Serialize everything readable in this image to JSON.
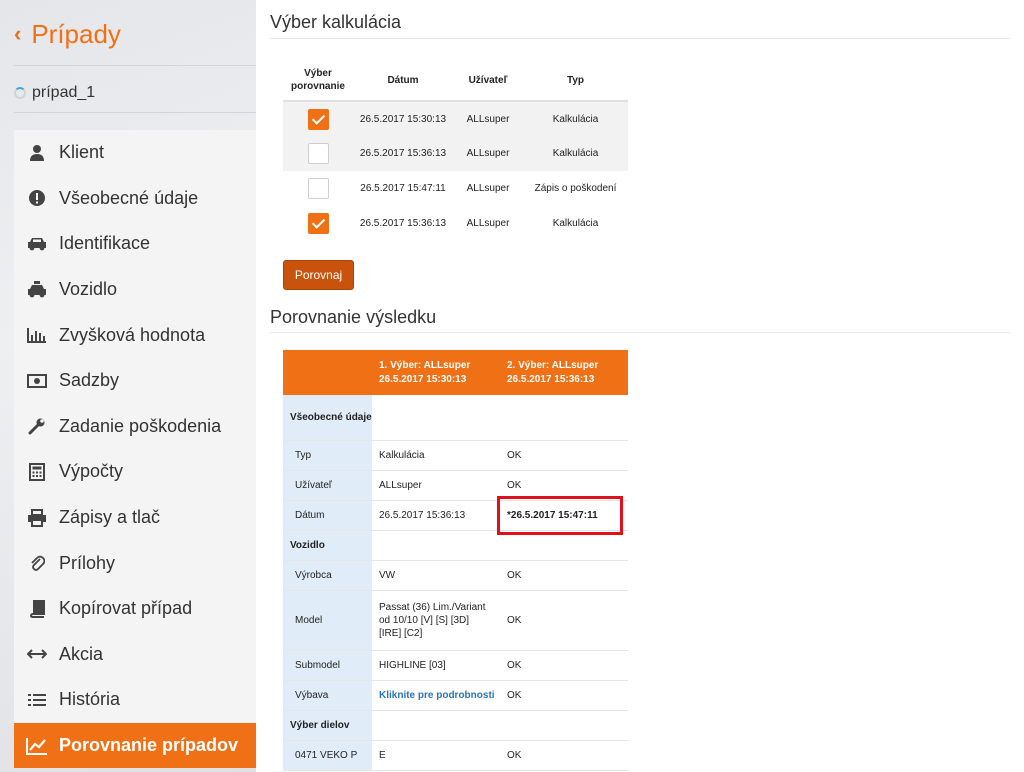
{
  "sidebar": {
    "back_label": "Prípady",
    "case_name": "prípad_1",
    "items": [
      {
        "label": "Klient",
        "icon": "user-icon"
      },
      {
        "label": "Všeobecné údaje",
        "icon": "exclamation-circle-icon"
      },
      {
        "label": "Identifikace",
        "icon": "car-icon"
      },
      {
        "label": "Vozidlo",
        "icon": "taxi-icon"
      },
      {
        "label": "Zvyšková hodnota",
        "icon": "bar-chart-icon"
      },
      {
        "label": "Sadzby",
        "icon": "money-icon"
      },
      {
        "label": "Zadanie poškodenia",
        "icon": "wrench-icon"
      },
      {
        "label": "Výpočty",
        "icon": "calculator-icon"
      },
      {
        "label": "Zápisy a tlač",
        "icon": "printer-icon"
      },
      {
        "label": "Prílohy",
        "icon": "paperclip-icon"
      },
      {
        "label": "Kopírovat případ",
        "icon": "book-icon"
      },
      {
        "label": "Akcia",
        "icon": "arrows-horizontal-icon"
      },
      {
        "label": "História",
        "icon": "list-icon"
      },
      {
        "label": "Porovnanie prípadov",
        "icon": "line-chart-icon",
        "active": true
      }
    ]
  },
  "selection": {
    "title": "Výber kalkulácia",
    "headers": {
      "select": "Výber porovnanie",
      "date": "Dátum",
      "user": "Užívateľ",
      "type": "Typ"
    },
    "rows": [
      {
        "checked": true,
        "date": "26.5.2017 15:30:13",
        "user": "ALLsuper",
        "type": "Kalkulácia"
      },
      {
        "checked": false,
        "date": "26.5.2017 15:36:13",
        "user": "ALLsuper",
        "type": "Kalkulácia"
      },
      {
        "checked": false,
        "date": "26.5.2017 15:47:11",
        "user": "ALLsuper",
        "type": "Zápis o poškodení"
      },
      {
        "checked": true,
        "date": "26.5.2017 15:36:13",
        "user": "ALLsuper",
        "type": "Kalkulácia"
      }
    ],
    "compare_button": "Porovnaj"
  },
  "comparison": {
    "title": "Porovnanie výsledku",
    "col1": {
      "line1": "1. Výber: ALLsuper",
      "line2": "26.5.2017 15:30:13"
    },
    "col2": {
      "line1": "2. Výber: ALLsuper",
      "line2": "26.5.2017 15:36:13"
    },
    "sec_general": "Všeobecné údaje",
    "typ": {
      "label": "Typ",
      "v1": "Kalkulácia",
      "v2": "OK"
    },
    "user": {
      "label": "Užívateľ",
      "v1": "ALLsuper",
      "v2": "OK"
    },
    "date": {
      "label": "Dátum",
      "v1": "26.5.2017 15:36:13",
      "v2": "*26.5.2017 15:47:11"
    },
    "sec_vehicle": "Vozidlo",
    "maker": {
      "label": "Výrobca",
      "v1": "VW",
      "v2": "OK"
    },
    "model": {
      "label": "Model",
      "v1a": "Passat (36) Lim./Variant",
      "v1b": "od 10/10 [V] [S] [3D]",
      "v1c": "[IRE] [C2]",
      "v2": "OK"
    },
    "submodel": {
      "label": "Submodel",
      "v1": "HIGHLINE [03]",
      "v2": "OK"
    },
    "equip": {
      "label": "Výbava",
      "v1": "Kliknite pre podrobnosti",
      "v2": "OK"
    },
    "sec_parts": "Výber dielov",
    "part1": {
      "label": "0471 VEKO P",
      "v1": "E",
      "v2": "OK"
    }
  },
  "colors": {
    "accent": "#f07015",
    "button": "#c9530c",
    "diff": "#f2b705",
    "highlight_border": "#e0111b",
    "label_bg": "#e0ecf8"
  }
}
